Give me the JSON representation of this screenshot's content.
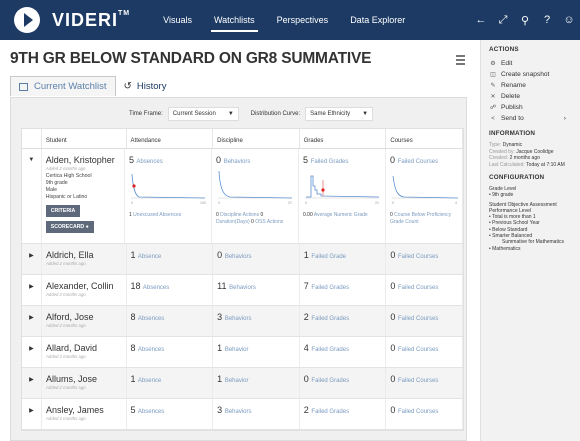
{
  "nav": {
    "brand": "VIDERI",
    "trademark": "TM",
    "links": [
      "Visuals",
      "Watchlists",
      "Perspectives",
      "Data Explorer"
    ],
    "active_link": "Watchlists"
  },
  "page": {
    "title": "9TH GR BELOW STANDARD ON GR8 SUMMATIVE",
    "tabs": {
      "current": "Current Watchlist",
      "history": "History"
    }
  },
  "filters": {
    "time_frame_label": "Time Frame:",
    "time_frame_value": "Current Session",
    "distribution_label": "Distribution Curve:",
    "distribution_value": "Same Ethnicity"
  },
  "table": {
    "headers": [
      "Student",
      "Attendance",
      "Discipline",
      "Grades",
      "Courses"
    ],
    "expanded": {
      "name": "Alden, Kristopher",
      "added": "Added 2 months ago",
      "school": "Certica High School",
      "grade": "9th grade",
      "gender": "Male",
      "ethnicity": "Hispanic or Latino",
      "criteria_btn": "CRITERIA",
      "scorecard_btn": "SCORECARD",
      "attendance": {
        "count": "5",
        "label": "Absences",
        "sub_count": "1",
        "sub_label": "Unexcused Absences"
      },
      "discipline": {
        "count": "0",
        "label": "Behaviors",
        "sub1_count": "0",
        "sub1_label": "Discipline Actions",
        "sub2_count": "0",
        "sub2_label": "Duration(Days)",
        "sub3_count": "0",
        "sub3_label": "OSS Actions"
      },
      "grades": {
        "count": "5",
        "label": "Failed Grades",
        "sub_count": "0.00",
        "sub_label": "Average Numeric Grade"
      },
      "courses": {
        "count": "0",
        "label": "Failed Courses",
        "sub_count": "0",
        "sub_label": "Course Below Proficiency Grade Count"
      },
      "charts": {
        "attendance_ticks": [
          "0",
          "100"
        ],
        "discipline_ticks": [
          "0",
          "37"
        ],
        "grades_ticks": [
          "0",
          "21"
        ],
        "courses_ticks": [
          "0",
          "4"
        ]
      }
    },
    "rows": [
      {
        "name": "Aldrich, Ella",
        "added": "Added 2 months ago",
        "att": "1",
        "att_label": "Absence",
        "dis": "0",
        "dis_label": "Behaviors",
        "gr": "1",
        "gr_label": "Failed Grade",
        "co": "0",
        "co_label": "Failed Courses"
      },
      {
        "name": "Alexander, Collin",
        "added": "Added 2 months ago",
        "att": "18",
        "att_label": "Absences",
        "dis": "11",
        "dis_label": "Behaviors",
        "gr": "7",
        "gr_label": "Failed Grades",
        "co": "0",
        "co_label": "Failed Courses"
      },
      {
        "name": "Alford, Jose",
        "added": "Added 2 months ago",
        "att": "8",
        "att_label": "Absences",
        "dis": "3",
        "dis_label": "Behaviors",
        "gr": "2",
        "gr_label": "Failed Grades",
        "co": "0",
        "co_label": "Failed Courses"
      },
      {
        "name": "Allard, David",
        "added": "Added 2 months ago",
        "att": "8",
        "att_label": "Absences",
        "dis": "1",
        "dis_label": "Behavior",
        "gr": "4",
        "gr_label": "Failed Grades",
        "co": "0",
        "co_label": "Failed Courses"
      },
      {
        "name": "Allums, Jose",
        "added": "Added 2 months ago",
        "att": "1",
        "att_label": "Absence",
        "dis": "1",
        "dis_label": "Behavior",
        "gr": "0",
        "gr_label": "Failed Grades",
        "co": "0",
        "co_label": "Failed Courses"
      },
      {
        "name": "Ansley, James",
        "added": "Added 2 months ago",
        "att": "5",
        "att_label": "Absences",
        "dis": "3",
        "dis_label": "Behaviors",
        "gr": "2",
        "gr_label": "Failed Grades",
        "co": "0",
        "co_label": "Failed Courses"
      }
    ]
  },
  "sidebar": {
    "actions_title": "ACTIONS",
    "actions": [
      "Edit",
      "Create snapshot",
      "Rename",
      "Delete",
      "Publish",
      "Send to"
    ],
    "info_title": "INFORMATION",
    "info": [
      {
        "k": "Type:",
        "v": "Dynamic"
      },
      {
        "k": "Created by:",
        "v": "Jacque Coolidge"
      },
      {
        "k": "Created:",
        "v": "2 months ago"
      },
      {
        "k": "Last Calculated:",
        "v": "Today at 7:10 AM"
      }
    ],
    "config_title": "CONFIGURATION",
    "config_grade_label": "Grade Level",
    "config_grade_value": "9th grade",
    "config_soa_label": "Student Objective Assessment Performance Level",
    "config_soa_items": [
      "Total is more than 1",
      "Previous School Year",
      "Below Standard",
      "Smarter Balanced",
      "Summative for Mathematics",
      "Mathematics"
    ]
  },
  "colors": {
    "nav_bg": "#1c3a63",
    "link_blue": "#7a9bc0",
    "marker_red": "#e02020",
    "chart_blue": "#5b8fd0"
  }
}
